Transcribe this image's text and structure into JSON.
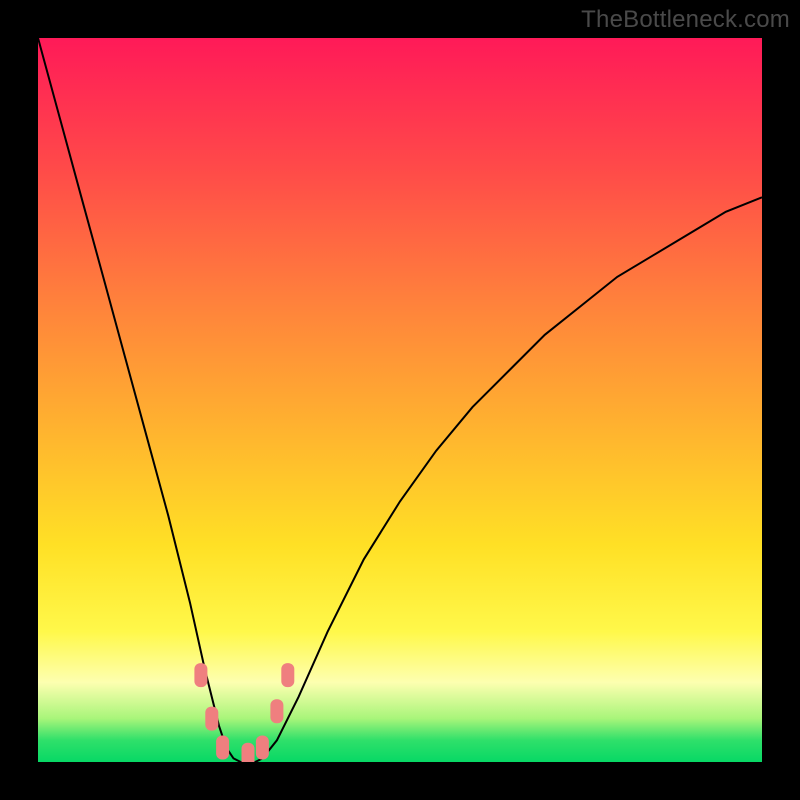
{
  "watermark": "TheBottleneck.com",
  "colors": {
    "frame": "#000000",
    "gradient_top": "#ff1a58",
    "gradient_mid": "#ffe025",
    "gradient_bottom": "#07d865",
    "curve": "#000000",
    "marker": "#ef7f7f"
  },
  "chart_data": {
    "type": "line",
    "title": "",
    "xlabel": "",
    "ylabel": "",
    "xlim": [
      0,
      100
    ],
    "ylim": [
      0,
      100
    ],
    "note": "V-shaped bottleneck curve. y ≈ 100 at x=0, drops steeply to ~0 near x≈26, stays ~0 through x≈31, then rises with decreasing slope toward ~78 at x=100. Green zone (no bottleneck) is roughly y < 10.",
    "series": [
      {
        "name": "bottleneck-curve",
        "x": [
          0,
          3,
          6,
          9,
          12,
          15,
          18,
          21,
          23,
          25,
          26,
          27,
          28,
          29,
          30,
          31,
          33,
          36,
          40,
          45,
          50,
          55,
          60,
          65,
          70,
          75,
          80,
          85,
          90,
          95,
          100
        ],
        "y": [
          100,
          89,
          78,
          67,
          56,
          45,
          34,
          22,
          13,
          5,
          2,
          0.5,
          0,
          0,
          0,
          0.5,
          3,
          9,
          18,
          28,
          36,
          43,
          49,
          54,
          59,
          63,
          67,
          70,
          73,
          76,
          78
        ]
      }
    ],
    "markers": {
      "name": "highlight-dots",
      "note": "Small salmon rounded markers clustered around the trough, roughly where curve crosses into/out of the green band (y ≲ 12).",
      "points": [
        {
          "x": 22.5,
          "y": 12
        },
        {
          "x": 24,
          "y": 6
        },
        {
          "x": 25.5,
          "y": 2
        },
        {
          "x": 29,
          "y": 1
        },
        {
          "x": 31,
          "y": 2
        },
        {
          "x": 33,
          "y": 7
        },
        {
          "x": 34.5,
          "y": 12
        }
      ]
    }
  }
}
